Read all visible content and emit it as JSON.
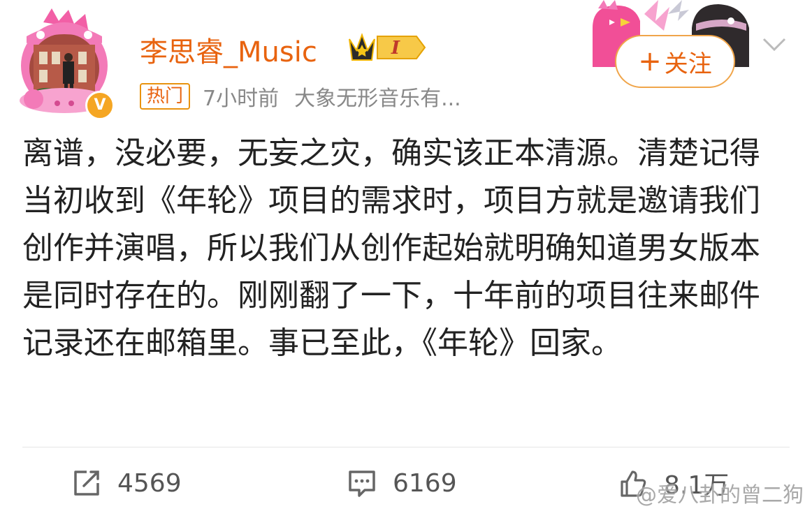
{
  "user": {
    "name": "李思睿_Music",
    "verified_badge": "V",
    "vip_level": "I"
  },
  "meta": {
    "hot_tag": "热门",
    "time": "7小时前",
    "source": "大象无形音乐有..."
  },
  "follow": {
    "plus": "+",
    "label": "关注"
  },
  "post": {
    "text": "离谱，没必要，无妄之灾，确实该正本清源。清楚记得当初收到《年轮》项目的需求时，项目方就是邀请我们创作并演唱，所以我们从创作起始就明确知道男女版本是同时存在的。刚刚翻了一下，十年前的项目往来邮件记录还在邮箱里。事已至此，《年轮》回家。"
  },
  "actions": {
    "repost_count": "4569",
    "comment_count": "6169",
    "like_count": "8.1万"
  },
  "watermark": "@爱八卦的曾二狗",
  "colors": {
    "accent": "#e8630f",
    "border": "#f0a54a",
    "text": "#222222"
  }
}
